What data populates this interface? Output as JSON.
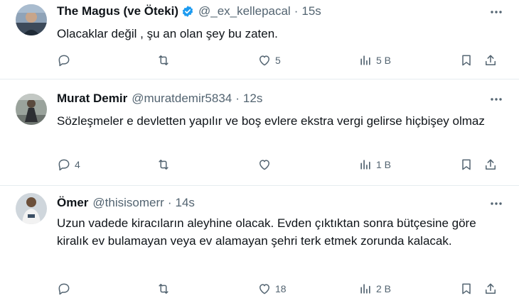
{
  "tweets": [
    {
      "name": "The Magus (ve Öteki)",
      "verified": true,
      "handle": "@_ex_kellepacal",
      "time": "15s",
      "text": "Olacaklar değil , şu an olan şey bu zaten.",
      "replies": "",
      "retweets": "",
      "likes": "5",
      "views": "5 B"
    },
    {
      "name": "Murat Demir",
      "verified": false,
      "handle": "@muratdemir5834",
      "time": "12s",
      "text": "Sözleşmeler e devletten yapılır ve boş evlere ekstra vergi gelirse hiçbişey olmaz",
      "replies": "4",
      "retweets": "",
      "likes": "",
      "views": "1 B"
    },
    {
      "name": "Ömer",
      "verified": false,
      "handle": "@thisisomerr",
      "time": "14s",
      "text": "Uzun vadede kiracıların aleyhine olacak. Evden çıktıktan sonra bütçesine göre kiralık ev bulamayan veya ev alamayan şehri terk etmek zorunda kalacak.",
      "replies": "",
      "retweets": "",
      "likes": "18",
      "views": "2 B"
    }
  ],
  "colors": {
    "accent": "#1d9bf0",
    "muted": "#536471",
    "text": "#0f1419",
    "divider": "#e6ecf0"
  },
  "icons": [
    "reply-icon",
    "retweet-icon",
    "like-icon",
    "views-icon",
    "bookmark-icon",
    "share-icon",
    "more-icon",
    "verified-icon"
  ]
}
